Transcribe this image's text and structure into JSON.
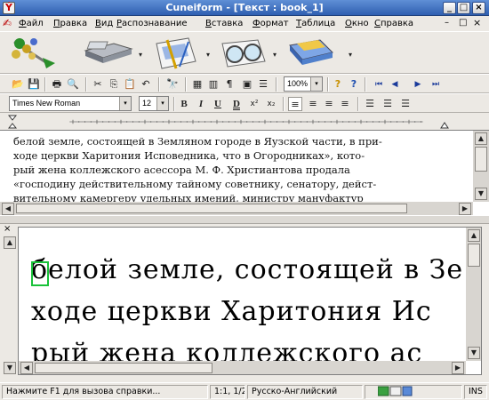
{
  "window": {
    "title": "Cuneiform - [Текст : book_1]",
    "app_glyph": "Ý",
    "min_label": "_",
    "max_label": "□",
    "close_label": "×"
  },
  "menu": [
    "Файл",
    "Правка",
    "Вид",
    "Распознавание",
    "Вставка",
    "Формат",
    "Таблица",
    "Окно",
    "Справка"
  ],
  "mdi_controls": {
    "min": "–",
    "restore": "□",
    "close": "×"
  },
  "big_toolbar": {
    "icons": [
      "scan-wizard-icon",
      "scanner-icon",
      "layout-icon",
      "glasses-recognize-icon",
      "export-icon"
    ],
    "dropdown_glyph": "▾"
  },
  "toolbar": {
    "zoom_value": "100%",
    "zoom_arrow": "▾",
    "glyphs": {
      "open": "📂",
      "save": "💾",
      "print": "🖶",
      "preview": "🔍",
      "cut": "✂",
      "copy": "⎘",
      "paste": "📋",
      "undo": "↶",
      "find": "🔭",
      "table1": "▦",
      "table2": "▥",
      "pilcrow": "¶",
      "frame": "▣",
      "lines": "☰",
      "help": "?",
      "context_help": "?",
      "first": "⏮",
      "prev": "◀",
      "next": "▶",
      "last": "⏭"
    }
  },
  "format_toolbar": {
    "font_name": "Times New Roman",
    "font_size": "12",
    "bold": "B",
    "italic": "I",
    "underline": "U",
    "double_underline": "D",
    "superscript": "x²",
    "subscript": "x₂",
    "align_glyphs": [
      "≡",
      "≡",
      "≡",
      "≡"
    ],
    "list_glyphs": [
      "☰",
      "☰",
      "☰"
    ]
  },
  "editor": {
    "lines": [
      "белой земле, состоящей в Земляном городе в Яузской части, в при-",
      "ходе церкви Харитония Исповедника, что в Огородниках», кото-",
      "рый жена коллежского асессора М. Ф. Христиантова продала",
      "«господину действительному тайному советнику, сенатору, дейст-",
      "вительному камергеру удельных имений, министру мануфактур"
    ]
  },
  "image_pane": {
    "lines": [
      "белой земле, состоящей в Зе",
      "ходе церкви Харитония Ис",
      "рый жена коллежского ас"
    ]
  },
  "scroll": {
    "up": "▲",
    "down": "▼",
    "left": "◀",
    "right": "▶",
    "pane_close": "×"
  },
  "status": {
    "hint": "Нажмите F1 для вызова справки...",
    "position": "1:1, 1/2",
    "language": "Русско-Английский",
    "mode": "INS"
  }
}
